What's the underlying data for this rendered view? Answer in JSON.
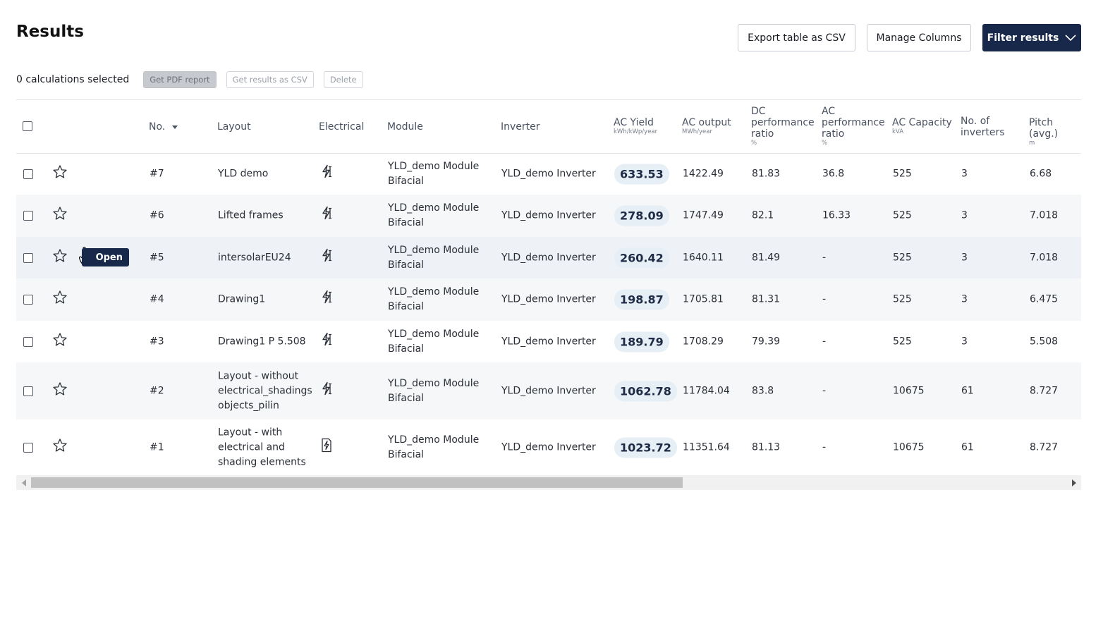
{
  "header": {
    "title": "Results",
    "export_label": "Export table as CSV",
    "manage_label": "Manage Columns",
    "filter_label": "Filter results"
  },
  "selection": {
    "status": "0 calculations selected",
    "pdf_label": "Get PDF report",
    "csv_label": "Get results as CSV",
    "delete_label": "Delete"
  },
  "columns": {
    "no": "No.",
    "layout": "Layout",
    "electrical": "Electrical",
    "module": "Module",
    "inverter": "Inverter",
    "ac_yield": "AC Yield",
    "ac_yield_unit": "kWh/kWp/year",
    "ac_output": "AC output",
    "ac_output_unit": "MWh/year",
    "dc_pr_1": "DC",
    "dc_pr_2": "performance",
    "dc_pr_3": "ratio",
    "dc_pr_unit": "%",
    "ac_pr_1": "AC",
    "ac_pr_2": "performance",
    "ac_pr_3": "ratio",
    "ac_pr_unit": "%",
    "ac_capacity": "AC Capacity",
    "ac_capacity_unit": "kVA",
    "inverters_1": "No. of",
    "inverters_2": "inverters",
    "pitch": "Pitch (avg.)",
    "pitch_unit": "m"
  },
  "tooltip": {
    "label": "Open"
  },
  "rows": [
    {
      "no": "#7",
      "layout_lines": [
        "YLD demo"
      ],
      "electrical_icon": "lightning-cursor-icon",
      "module_1": "YLD_demo Module",
      "module_2": "Bifacial",
      "inverter": "YLD_demo Inverter",
      "ac_yield": "633.53",
      "ac_output": "1422.49",
      "dc_pr": "81.83",
      "ac_pr": "36.8",
      "ac_capacity": "525",
      "inverters": "3",
      "pitch": "6.68"
    },
    {
      "no": "#6",
      "layout_lines": [
        "Lifted frames"
      ],
      "electrical_icon": "lightning-cursor-icon",
      "module_1": "YLD_demo Module",
      "module_2": "Bifacial",
      "inverter": "YLD_demo Inverter",
      "ac_yield": "278.09",
      "ac_output": "1747.49",
      "dc_pr": "82.1",
      "ac_pr": "16.33",
      "ac_capacity": "525",
      "inverters": "3",
      "pitch": "7.018"
    },
    {
      "no": "#5",
      "layout_lines": [
        "intersolarEU24"
      ],
      "electrical_icon": "lightning-cursor-icon",
      "module_1": "YLD_demo Module",
      "module_2": "Bifacial",
      "inverter": "YLD_demo Inverter",
      "ac_yield": "260.42",
      "ac_output": "1640.11",
      "dc_pr": "81.49",
      "ac_pr": "-",
      "ac_capacity": "525",
      "inverters": "3",
      "pitch": "7.018"
    },
    {
      "no": "#4",
      "layout_lines": [
        "Drawing1"
      ],
      "electrical_icon": "lightning-cursor-icon",
      "module_1": "YLD_demo Module",
      "module_2": "Bifacial",
      "inverter": "YLD_demo Inverter",
      "ac_yield": "198.87",
      "ac_output": "1705.81",
      "dc_pr": "81.31",
      "ac_pr": "-",
      "ac_capacity": "525",
      "inverters": "3",
      "pitch": "6.475"
    },
    {
      "no": "#3",
      "layout_lines": [
        "Drawing1 P 5.508"
      ],
      "electrical_icon": "lightning-cursor-icon",
      "module_1": "YLD_demo Module",
      "module_2": "Bifacial",
      "inverter": "YLD_demo Inverter",
      "ac_yield": "189.79",
      "ac_output": "1708.29",
      "dc_pr": "79.39",
      "ac_pr": "-",
      "ac_capacity": "525",
      "inverters": "3",
      "pitch": "5.508"
    },
    {
      "no": "#2",
      "layout_lines": [
        "Layout - without",
        "electrical_shadings",
        "objects_pilin"
      ],
      "electrical_icon": "lightning-cursor-icon",
      "module_1": "YLD_demo Module",
      "module_2": "Bifacial",
      "inverter": "YLD_demo Inverter",
      "ac_yield": "1062.78",
      "ac_output": "11784.04",
      "dc_pr": "83.8",
      "ac_pr": "-",
      "ac_capacity": "10675",
      "inverters": "61",
      "pitch": "8.727"
    },
    {
      "no": "#1",
      "layout_lines": [
        "Layout - with",
        "electrical and",
        "shading elements"
      ],
      "electrical_icon": "lightning-document-icon",
      "module_1": "YLD_demo Module",
      "module_2": "Bifacial",
      "inverter": "YLD_demo Inverter",
      "ac_yield": "1023.72",
      "ac_output": "11351.64",
      "dc_pr": "81.13",
      "ac_pr": "-",
      "ac_capacity": "10675",
      "inverters": "61",
      "pitch": "8.727"
    }
  ],
  "colors": {
    "primary": "#17284a",
    "yield_pill": "#e6eef6",
    "row_alt": "#f6f7f9"
  }
}
